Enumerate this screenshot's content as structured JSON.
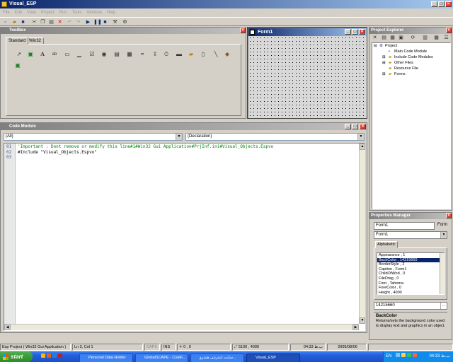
{
  "window": {
    "title": "Visual_ESP"
  },
  "menu": [
    "File",
    "Edit",
    "View",
    "Project",
    "Run",
    "Tools",
    "Window",
    "Help"
  ],
  "toolbox": {
    "title": "ToolBox",
    "tabs": [
      "Standard",
      "Win32"
    ]
  },
  "form": {
    "title": "Form1"
  },
  "code": {
    "title": "Code Module",
    "object_combo": "(All)",
    "proc_combo": "(Declaration)",
    "line_numbers": [
      "01",
      "02",
      "03"
    ],
    "lines": [
      "'Important : Dont remove or modify this line#1#Win32 Gui Application#PrjInf.ini#Visual_Objects.Espvo",
      "#Include \"Visual_Objects.Espvo\"",
      ""
    ]
  },
  "explorer": {
    "title": "Project Explorer",
    "root": "Project",
    "items": [
      "Main Code Module",
      "Include Code Modules",
      "Other Files",
      "Resource File",
      "Forms"
    ]
  },
  "properties": {
    "title": "Properties Manager",
    "name_value": "Form1",
    "name_label": "Form",
    "object_combo": "Form1",
    "tab": "Alphabetic",
    "rows": [
      "Appearance , 1",
      "BackColor , 14215660",
      "BorderStyle , 2",
      "Caption , Form1",
      "ChildOfWnd , 0",
      "FileDrag , 0",
      "Font , Tahoma",
      "ForeColor , 0",
      "Height , 4000"
    ],
    "selected_index": 1,
    "edit_value": "14215660",
    "desc_title": "BackColor",
    "desc_text": "Returns/sets the background color used to display text and graphics in an object."
  },
  "status": {
    "project": "Esp Project ( Win32 Gui Application )",
    "pos": "Ln 3, Col 1",
    "caps": "CAPS",
    "ins": "INS",
    "coord": "0 , 0",
    "size": "5100 , 4000",
    "time": "04:33 ب.ظ",
    "date": "2009/08/06"
  },
  "taskbar": {
    "start": "start",
    "tasks": [
      "Personal Data Holder",
      "GlobalSCAPE - CuteF...",
      "سایت اینترنتی هینترو...",
      "Visual_ESP"
    ],
    "lang": "EN",
    "clock": "04:33 ب.ظ"
  },
  "colors": {
    "title_active": "#0a246a",
    "title_gradient_end": "#a6caf0",
    "comment_green": "#008000",
    "taskbar": "#245edb",
    "start_green": "#3a9b3a"
  }
}
